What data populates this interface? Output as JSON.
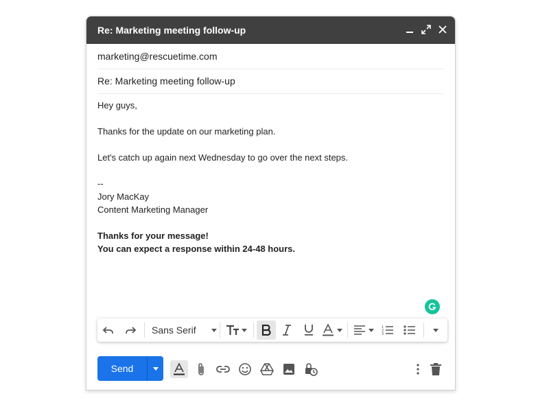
{
  "window": {
    "title": "Re: Marketing meeting follow-up",
    "controls": [
      "minimize-icon",
      "expand-icon",
      "close-icon"
    ]
  },
  "recipients": {
    "to": "marketing@rescuetime.com"
  },
  "subject": "Re: Marketing meeting follow-up",
  "body": {
    "greeting": "Hey guys,",
    "line1": "Thanks for the update on our marketing plan.",
    "line2": "Let's catch up again next Wednesday to go over the next steps.",
    "signature": [
      "--",
      "Jory MacKay",
      "Content Marketing Manager"
    ],
    "autoreply": [
      "Thanks for your message!",
      "You can expect a response within 24-48 hours."
    ]
  },
  "format_bar": {
    "font": "Sans Serif",
    "icons": [
      "undo-icon",
      "redo-icon",
      "font-size-icon",
      "bold-icon",
      "italic-icon",
      "underline-icon",
      "text-color-icon",
      "align-icon",
      "numbered-list-icon",
      "bulleted-list-icon",
      "more-formatting-icon"
    ]
  },
  "footer": {
    "send_label": "Send",
    "icons": [
      "formatting-options-icon",
      "attach-icon",
      "link-icon",
      "emoji-icon",
      "drive-icon",
      "photo-icon",
      "confidential-mode-icon",
      "more-options-icon",
      "delete-icon"
    ]
  },
  "colors": {
    "titlebar": "#404040",
    "send": "#1a73e8",
    "grammarly": "#15c39a"
  }
}
